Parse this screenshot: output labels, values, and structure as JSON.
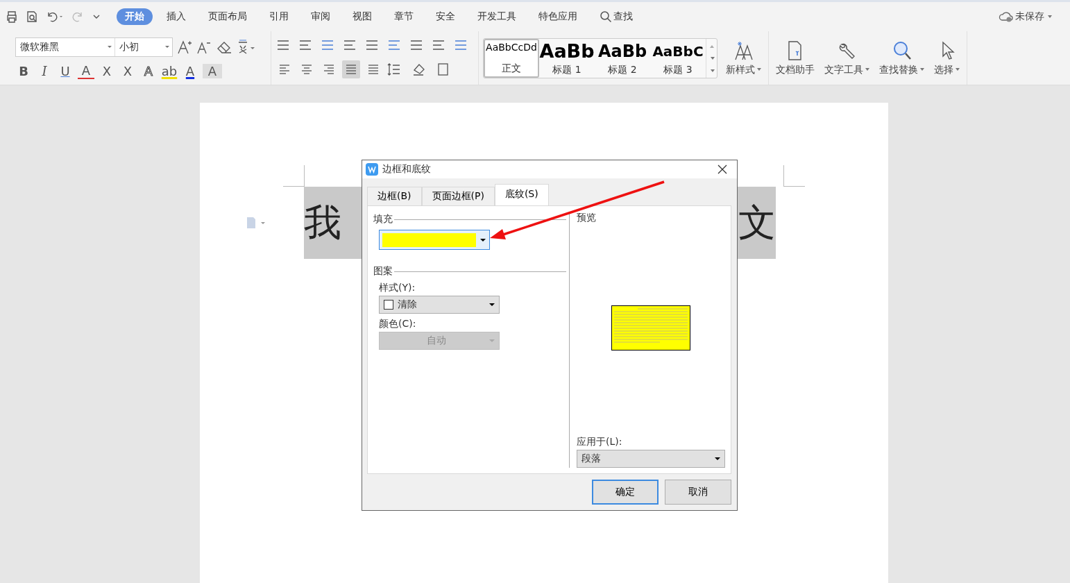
{
  "menu_tabs": [
    {
      "label": "开始",
      "selected": true
    },
    {
      "label": "插入",
      "selected": false
    },
    {
      "label": "页面布局",
      "selected": false
    },
    {
      "label": "引用",
      "selected": false
    },
    {
      "label": "审阅",
      "selected": false
    },
    {
      "label": "视图",
      "selected": false
    },
    {
      "label": "章节",
      "selected": false
    },
    {
      "label": "安全",
      "selected": false
    },
    {
      "label": "开发工具",
      "selected": false
    },
    {
      "label": "特色应用",
      "selected": false
    }
  ],
  "search": {
    "label": "查找"
  },
  "save_status": "未保存",
  "font": {
    "name": "微软雅黑",
    "size": "小初"
  },
  "format_buttons": [
    {
      "kind": "bold",
      "glyph": "B"
    },
    {
      "kind": "italic",
      "glyph": "I"
    },
    {
      "kind": "underline",
      "glyph": "U"
    },
    {
      "kind": "strike",
      "glyph": "A"
    },
    {
      "kind": "sup",
      "glyph": "X"
    },
    {
      "kind": "sub",
      "glyph": "X"
    },
    {
      "kind": "outline",
      "glyph": "A"
    },
    {
      "kind": "highlight",
      "glyph": "ab"
    },
    {
      "kind": "color",
      "glyph": "A"
    },
    {
      "kind": "shade",
      "glyph": "A"
    }
  ],
  "align_buttons": [
    {
      "kind": "left",
      "selected": false
    },
    {
      "kind": "center",
      "selected": false
    },
    {
      "kind": "right",
      "selected": false
    },
    {
      "kind": "justify",
      "selected": true
    },
    {
      "kind": "distribute",
      "selected": false
    }
  ],
  "styles": [
    {
      "preview": "AaBbCcDd",
      "label": "正文",
      "kind": "body",
      "selected": true
    },
    {
      "preview": "AaBb",
      "label": "标题 1",
      "kind": "h1",
      "selected": false
    },
    {
      "preview": "AaBb",
      "label": "标题 2",
      "kind": "h2",
      "selected": false
    },
    {
      "preview": "AaBbC",
      "label": "标题 3",
      "kind": "h3",
      "selected": false
    }
  ],
  "new_style": "新样式",
  "tools": [
    {
      "label": "文档助手",
      "kind": "doc",
      "dropdown": false
    },
    {
      "label": "文字工具",
      "kind": "wrench",
      "dropdown": true
    },
    {
      "label": "查找替换",
      "kind": "search",
      "dropdown": true
    },
    {
      "label": "选择",
      "kind": "pointer",
      "dropdown": true
    }
  ],
  "document": {
    "heading_left": "我",
    "heading_right": "文"
  },
  "dialog": {
    "title": "边框和底纹",
    "tabs": [
      {
        "label": "边框(B)",
        "selected": false
      },
      {
        "label": "页面边框(P)",
        "selected": false
      },
      {
        "label": "底纹(S)",
        "selected": true
      }
    ],
    "fill": {
      "label": "填充",
      "color": "#ffff00"
    },
    "pattern": {
      "label": "图案",
      "style_label": "样式(Y):",
      "style_value": "清除",
      "color_label": "颜色(C):",
      "color_value": "自动",
      "color_disabled": true
    },
    "preview": {
      "label": "预览"
    },
    "apply": {
      "label": "应用于(L):",
      "value": "段落"
    },
    "buttons": [
      {
        "label": "确定",
        "default": true
      },
      {
        "label": "取消",
        "default": false
      }
    ]
  }
}
